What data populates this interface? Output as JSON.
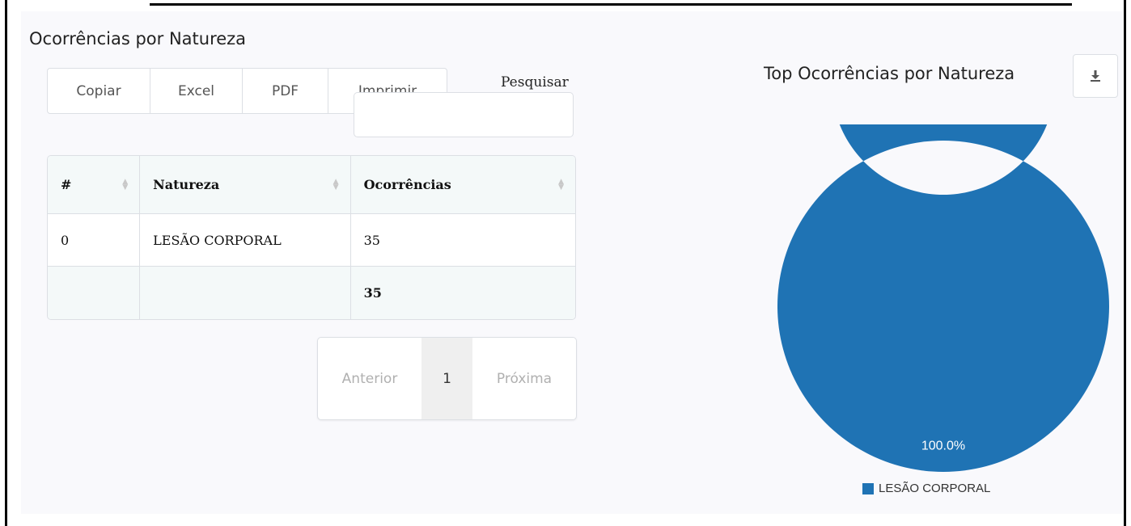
{
  "section_title": "Ocorrências por Natureza",
  "toolbar": {
    "copy_label": "Copiar",
    "excel_label": "Excel",
    "pdf_label": "PDF",
    "print_label": "Imprimir"
  },
  "search": {
    "label": "Pesquisar",
    "value": "",
    "placeholder": ""
  },
  "table": {
    "headers": [
      "#",
      "Natureza",
      "Ocorrências"
    ],
    "rows": [
      [
        "0",
        "LESÃO CORPORAL",
        "35"
      ]
    ],
    "footer": [
      "",
      "",
      "35"
    ]
  },
  "pagination": {
    "prev_label": "Anterior",
    "current_page": "1",
    "next_label": "Próxima"
  },
  "chart": {
    "title": "Top Ocorrências por Natureza",
    "download_icon": "download-icon"
  },
  "chart_data": {
    "type": "pie",
    "variant": "donut",
    "categories": [
      "LESÃO CORPORAL"
    ],
    "values": [
      35
    ],
    "data_labels": [
      "100.0%"
    ],
    "colors": [
      "#1f73b4"
    ],
    "legend": [
      "LESÃO CORPORAL"
    ],
    "legend_position": "bottom"
  }
}
